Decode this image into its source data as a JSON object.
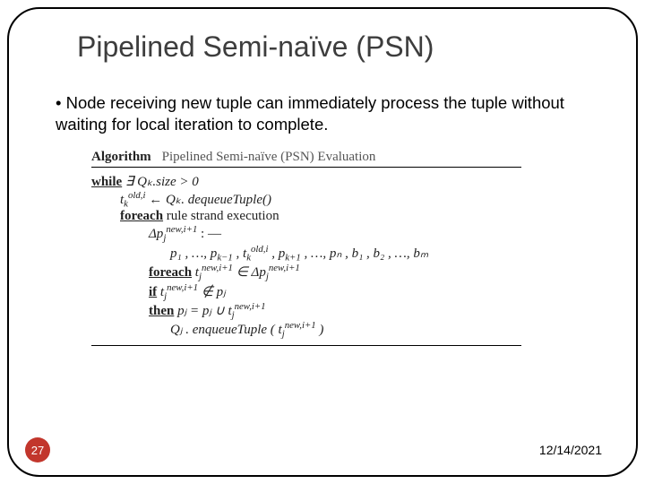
{
  "title": "Pipelined Semi-naïve (PSN)",
  "bullet": "• Node receiving new tuple can immediately process the tuple without waiting for local iteration to complete.",
  "algo": {
    "label": "Algorithm",
    "caption": "Pipelined Semi-naïve (PSN) Evaluation",
    "while_kw": "while",
    "while_cond": " ∃ Qₖ.size > 0",
    "l1_a": "t",
    "l1_sub": "k",
    "l1_sup": "old,i",
    "l1_b": " ← Qₖ. dequeueTuple()",
    "foreach_kw": "foreach",
    "foreach_txt": " rule strand execution",
    "l2_a": "Δp",
    "l2_sub": "j",
    "l2_sup": "new,i+1",
    "l2_b": " : —",
    "rhs_a": "p₁ , …, p",
    "rhs_km1": "k−1",
    "rhs_b": " , t",
    "rhs_tk_sub": "k",
    "rhs_tk_sup": "old,i",
    "rhs_c": " , p",
    "rhs_kp1": "k+1",
    "rhs_d": " , …, pₙ , b₁ , b₂ , …, bₘ",
    "foreach2_kw": "foreach",
    "fe2_a": " t",
    "fe2_sub": "j",
    "fe2_sup": "new,i+1",
    "fe2_b": " ∈ Δp",
    "fe2_sub2": "j",
    "fe2_sup2": "new,i+1",
    "if_kw": "if",
    "if_a": " t",
    "if_sub": "j",
    "if_sup": "new,i+1",
    "if_b": " ∉ pⱼ",
    "then_kw": "then",
    "then_a": " pⱼ = pⱼ ∪ t",
    "then_sub": "j",
    "then_sup": "new,i+1",
    "enq_a": "Qⱼ . enqueueTuple ( t",
    "enq_sub": "j",
    "enq_sup": "new,i+1",
    "enq_b": " )"
  },
  "page_number": "27",
  "date": "12/14/2021"
}
